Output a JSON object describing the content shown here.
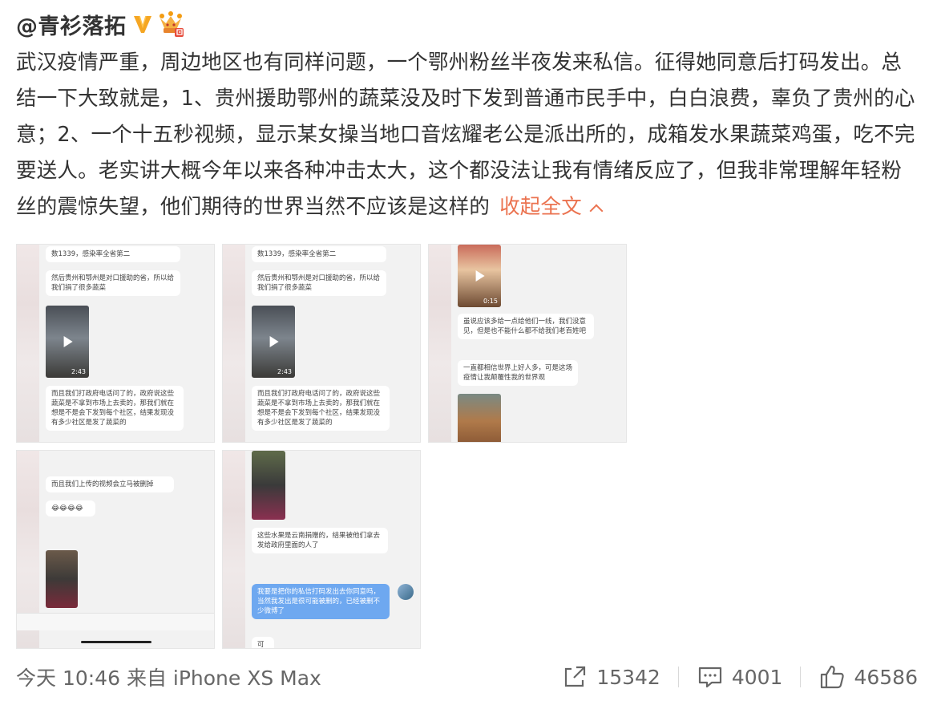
{
  "post": {
    "author": "@青衫落拓",
    "text": "武汉疫情严重，周边地区也有同样问题，一个鄂州粉丝半夜发来私信。征得她同意后打码发出。总结一下大致就是，1、贵州援助鄂州的蔬菜没及时下发到普通市民手中，白白浪费，辜负了贵州的心意；2、一个十五秒视频，显示某女操当地口音炫耀老公是派出所的，成箱发水果蔬菜鸡蛋，吃不完要送人。老实讲大概今年以来各种冲击太大，这个都没法让我有情绪反应了，但我非常理解年轻粉丝的震惊失望，他们期待的世界当然不应该是这样的",
    "collapse_label": "收起全文",
    "meta": "今天 10:46 来自 iPhone XS Max",
    "reposts": "15342",
    "comments": "4001",
    "likes": "46586"
  },
  "images": [
    {
      "top_snippet": "数1339，感染率全省第二",
      "msg_a": "然后贵州和鄂州是对口援助的省，所以给我们捐了很多蔬菜",
      "video_duration": "2:43",
      "msg_b": "而且我们打政府电话问了的，政府说这些蔬菜是不拿到市场上去卖的，那我们就在想是不是会下发到每个社区，结果发现没有多少社区是发了蔬菜的"
    },
    {
      "top_snippet": "数1339，感染率全省第二",
      "msg_a": "然后贵州和鄂州是对口援助的省，所以给我们捐了很多蔬菜",
      "video_duration": "2:43",
      "msg_b": "而且我们打政府电话问了的，政府说这些蔬菜是不拿到市场上去卖的，那我们就在想是不是会下发到每个社区，结果发现没有多少社区是发了蔬菜的"
    },
    {
      "video_duration": "0:15",
      "msg_a": "虽说应该多给一点给他们一线，我们没意见，但是也不能什么都不给我们老百姓吧",
      "msg_b": "一直都相信世界上好人多，可是这场疫情让我颠覆性我的世界观"
    },
    {
      "msg_a": "而且我们上传的视频会立马被删掉",
      "emoji": "😂😂😂😂"
    },
    {
      "msg_a": "这些水果是云南捐赠的，结果被他们拿去发给政府里面的人了",
      "msg_blue": "我要是把你的私信打码发出去你同意吗，当然我发出是很可能被删的，已经被删不少微博了",
      "msg_reply": "可以"
    }
  ]
}
